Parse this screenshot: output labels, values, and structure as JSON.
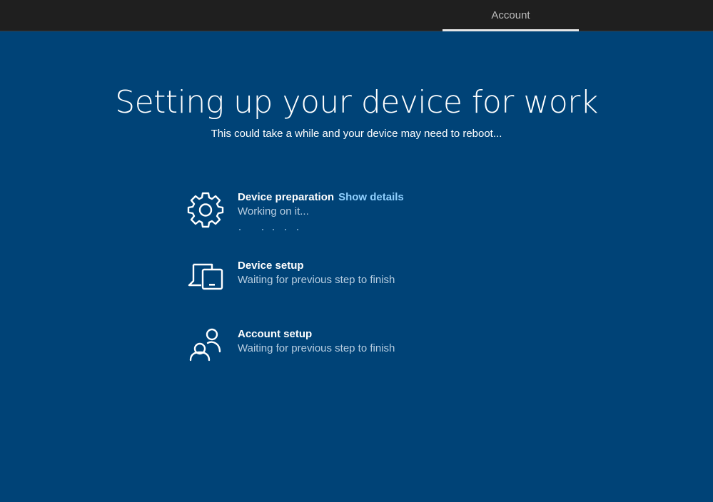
{
  "topbar": {
    "tab_label": "Account"
  },
  "main": {
    "title": "Setting up your device for work",
    "subtitle": "This could take a while and your device may need to reboot..."
  },
  "steps": [
    {
      "icon": "gear-icon",
      "title": "Device preparation",
      "link": "Show details",
      "status": "Working on it..."
    },
    {
      "icon": "devices-icon",
      "title": "Device setup",
      "status": "Waiting for previous step to finish"
    },
    {
      "icon": "people-icon",
      "title": "Account setup",
      "status": "Waiting for previous step to finish"
    }
  ],
  "colors": {
    "background": "#004377",
    "topbar": "#1f1f1f",
    "link": "#8fd0ff",
    "status_text": "#b7cde0"
  }
}
